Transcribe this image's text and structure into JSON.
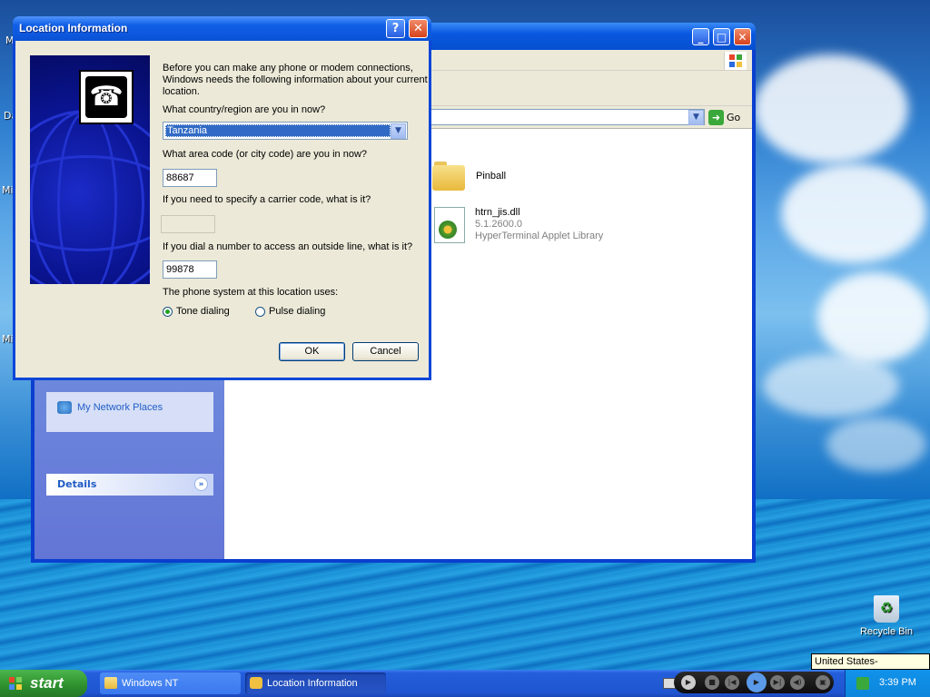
{
  "dialog": {
    "title": "Location Information",
    "intro": [
      "Before you can make any phone or modem connections,",
      "Windows needs the following information about your current",
      "location."
    ],
    "country_label": "What country/region are you in now?",
    "country_value": "Tanzania",
    "area_label": "What area code (or city code) are you in now?",
    "area_value": "88687",
    "carrier_label": "If you need to specify a carrier code, what is it?",
    "carrier_value": "",
    "outside_label": "If you dial a number to access an outside line, what is it?",
    "outside_value": "99878",
    "phone_system_label": "The phone system at this location uses:",
    "tone_label": "Tone dialing",
    "pulse_label": "Pulse dialing",
    "selected_dialing": "tone",
    "ok_label": "OK",
    "cancel_label": "Cancel",
    "help_glyph": "?",
    "close_glyph": "✕"
  },
  "explorer": {
    "go_label": "Go",
    "left_pane": {
      "network_places": "My Network Places",
      "details_header": "Details"
    },
    "files": [
      {
        "name": "Pinball",
        "icon": "folder-icon"
      },
      {
        "name": "htrn_jis.dll",
        "version": "5.1.2600.0",
        "description": "HyperTerminal Applet Library",
        "icon": "dll-icon"
      }
    ]
  },
  "desktop": {
    "partial_labels": [
      "M",
      "Da",
      "Mic",
      "Mic"
    ],
    "recycle_bin": "Recycle Bin",
    "tooltip": "United States-International"
  },
  "taskbar": {
    "start_label": "start",
    "buttons": [
      {
        "label": "Windows NT",
        "state": "inactive",
        "icon": "folder-icon"
      },
      {
        "label": "Location Information",
        "state": "active",
        "icon": "phone-icon"
      }
    ],
    "clock": "3:39 PM"
  },
  "colors": {
    "title_blue": "#0a52d6",
    "dialog_face": "#ece9d8",
    "selection_blue": "#316ac5",
    "start_green": "#2d8f2d"
  }
}
